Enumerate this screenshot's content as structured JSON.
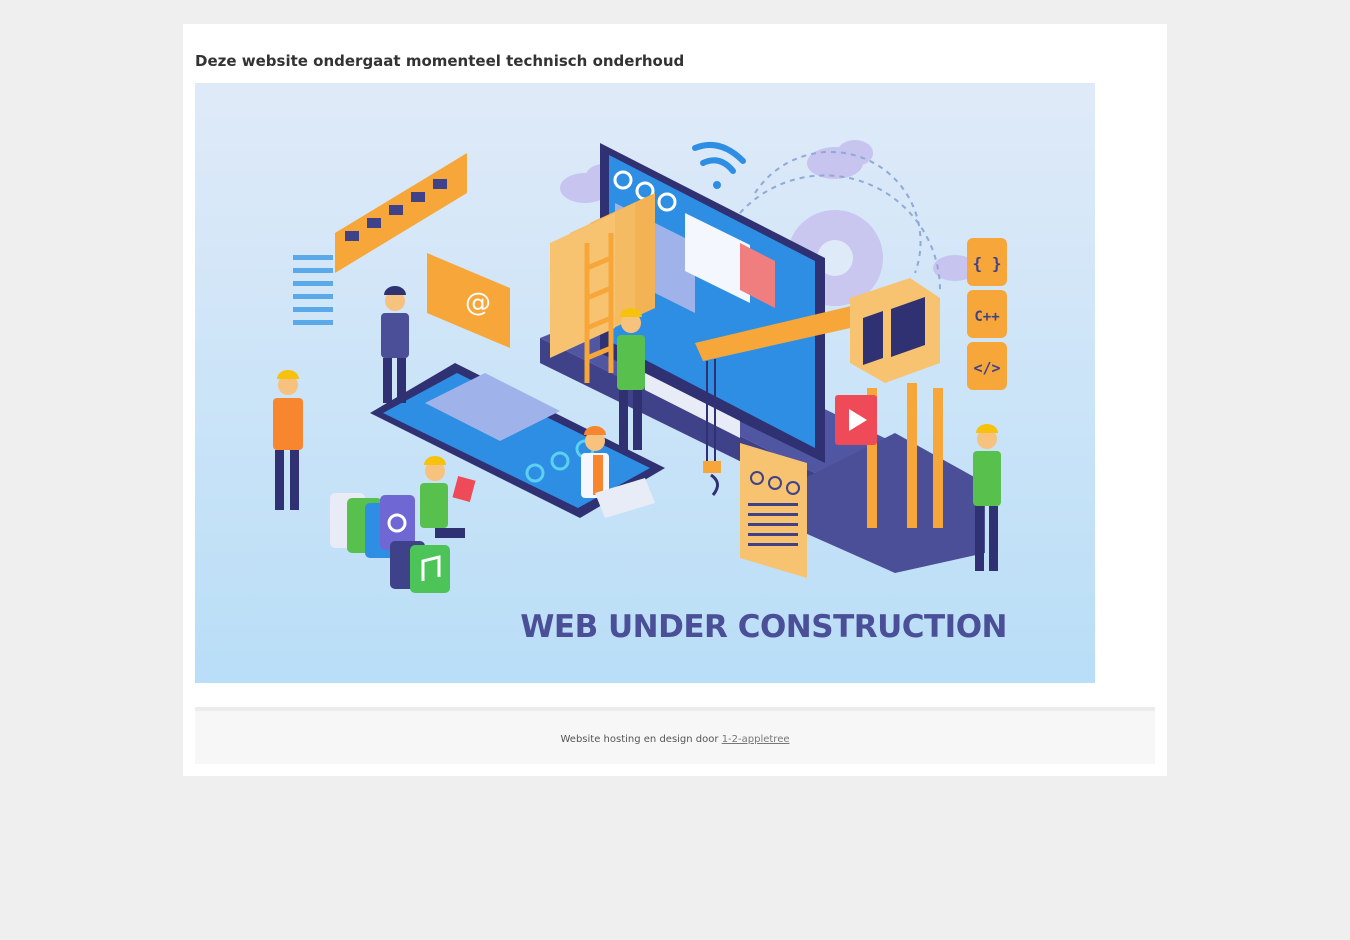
{
  "page": {
    "heading": "Deze website ondergaat momenteel technisch onderhoud"
  },
  "hero": {
    "banner_text": "WEB UNDER CONSTRUCTION",
    "code_tiles": [
      "{ }",
      "C++",
      "</>"
    ],
    "email_symbol": "@",
    "colors": {
      "sky_top": "#dfeaf8",
      "sky_bottom": "#b9def7",
      "navy": "#4b4f97",
      "orange": "#f7a73a",
      "screen_blue": "#2e8ee3",
      "worker_green": "#58c14e"
    }
  },
  "footer": {
    "prefix": "Website hosting en design door",
    "link_label": "1-2-appletree"
  }
}
